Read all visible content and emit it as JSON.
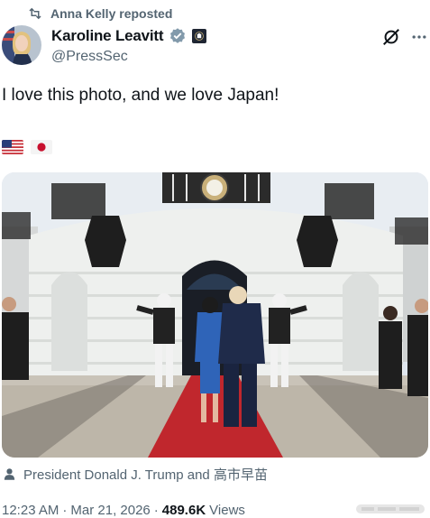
{
  "repost": {
    "text": "Anna Kelly reposted",
    "icon": "repost-icon"
  },
  "author": {
    "name": "Karoline Leavitt",
    "handle": "@PressSec",
    "verified_badge": "verified-badge-icon",
    "affiliation_badge": "white-house-seal-icon"
  },
  "header_actions": {
    "grok": "grok-icon",
    "more": "more-icon"
  },
  "tweet": {
    "text": "I love this photo, and we love Japan!",
    "flags": [
      "united-states-flag",
      "japan-flag"
    ]
  },
  "photo": {
    "description_icon": "person-icon",
    "tags": "President Donald J. Trump and 高市早苗"
  },
  "meta": {
    "time": "12:23 AM",
    "separator": "·",
    "date": "Mar 21, 2026",
    "views_count": "489.6K",
    "views_label": "Views"
  },
  "colors": {
    "text": "#0f1419",
    "muted": "#536471",
    "verified": "#829aab",
    "carpet": "#c0272d"
  }
}
